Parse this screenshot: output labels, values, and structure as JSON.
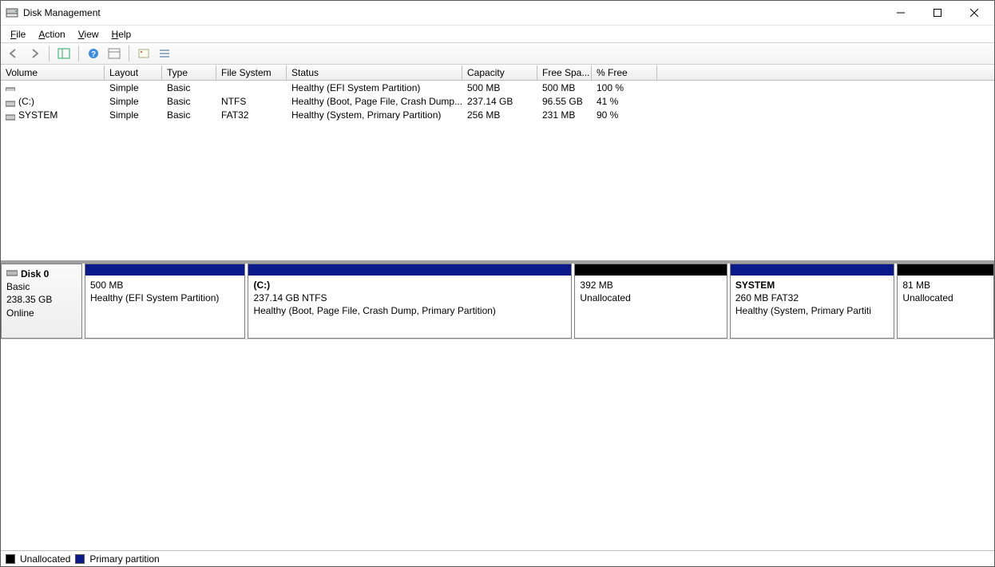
{
  "window": {
    "title": "Disk Management"
  },
  "menu": {
    "file": "File",
    "action": "Action",
    "view": "View",
    "help": "Help"
  },
  "toolbar_icons": {
    "back": "back-arrow",
    "forward": "forward-arrow",
    "up": "show-hide",
    "help": "help",
    "refresh": "refresh",
    "props": "properties",
    "list": "list-view"
  },
  "columns": {
    "volume": "Volume",
    "layout": "Layout",
    "type": "Type",
    "fs": "File System",
    "status": "Status",
    "capacity": "Capacity",
    "free": "Free Spa...",
    "pct": "% Free"
  },
  "volumes": [
    {
      "name": "",
      "layout": "Simple",
      "type": "Basic",
      "fs": "",
      "status": "Healthy (EFI System Partition)",
      "capacity": "500 MB",
      "free": "500 MB",
      "pct": "100 %"
    },
    {
      "name": "(C:)",
      "layout": "Simple",
      "type": "Basic",
      "fs": "NTFS",
      "status": "Healthy (Boot, Page File, Crash Dump...",
      "capacity": "237.14 GB",
      "free": "96.55 GB",
      "pct": "41 %"
    },
    {
      "name": "SYSTEM",
      "layout": "Simple",
      "type": "Basic",
      "fs": "FAT32",
      "status": "Healthy (System, Primary Partition)",
      "capacity": "256 MB",
      "free": "231 MB",
      "pct": "90 %"
    }
  ],
  "disk": {
    "label": "Disk 0",
    "type": "Basic",
    "size": "238.35 GB",
    "state": "Online",
    "partitions": [
      {
        "color": "blue",
        "name": "",
        "size": "500 MB",
        "status": "Healthy (EFI System Partition)",
        "flex": 200
      },
      {
        "color": "blue",
        "name": "(C:)",
        "size": "237.14 GB NTFS",
        "status": "Healthy (Boot, Page File, Crash Dump, Primary Partition)",
        "flex": 405
      },
      {
        "color": "black",
        "name": "",
        "size": "392 MB",
        "status": "Unallocated",
        "flex": 190
      },
      {
        "color": "blue",
        "name": "SYSTEM",
        "size": "260 MB FAT32",
        "status": "Healthy (System, Primary Partiti",
        "flex": 205
      },
      {
        "color": "black",
        "name": "",
        "size": "81 MB",
        "status": "Unallocated",
        "flex": 120
      }
    ]
  },
  "legend": {
    "unallocated": "Unallocated",
    "primary": "Primary partition"
  }
}
